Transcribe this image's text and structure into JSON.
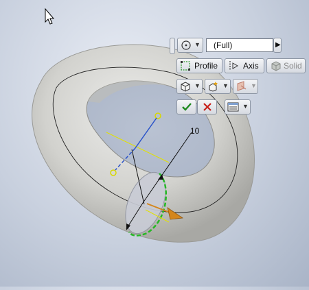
{
  "viewport": {
    "dimension_value": "10",
    "icons": {
      "cursor": "mouse-pointer-icon",
      "axis_handles": "circle-handle-icon",
      "revolve_arrow": "revolve-direction-arrow-icon"
    },
    "colors": {
      "torus": "#d4d4d0",
      "sketch_lines": "#222222",
      "axis_line": "#2a53c9",
      "axis_handle": "#d8d800",
      "profile_outline": "#25b825",
      "direction_arrow": "#d4861c"
    }
  },
  "minitoolbar": {
    "extent_dropdown": {
      "icon": "extent-circle-icon",
      "value": "(Full)"
    },
    "profile_button": {
      "icon": "profile-select-icon",
      "label": "Profile"
    },
    "axis_button": {
      "icon": "axis-select-icon",
      "label": "Axis"
    },
    "solid_button": {
      "icon": "solid-body-icon",
      "label": "Solid"
    },
    "output_dropdown": {
      "icon": "solid-output-icon"
    },
    "operation_dropdown": {
      "icon": "join-operation-icon"
    },
    "direction_dropdown": {
      "icon": "direction-icon"
    },
    "ok_button": {
      "icon": "checkmark-icon",
      "color": "#1f8a1f"
    },
    "cancel_button": {
      "icon": "x-icon",
      "color": "#c8201a"
    },
    "options_dropdown": {
      "icon": "options-menu-icon"
    }
  }
}
